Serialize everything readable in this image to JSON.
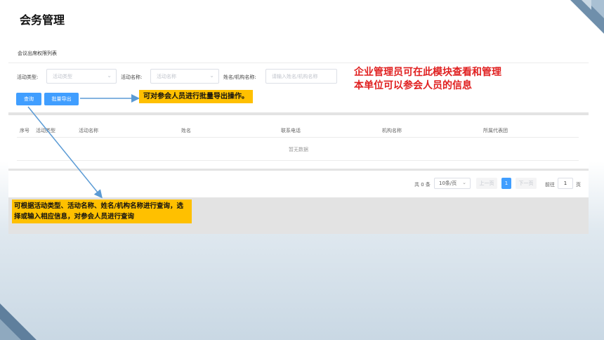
{
  "slide": {
    "title": "会务管理"
  },
  "card": {
    "title": "会议出席权限列表"
  },
  "filters": {
    "activity_type": {
      "label": "活动类型:",
      "placeholder": "活动类型"
    },
    "activity_name": {
      "label": "活动名称:",
      "placeholder": "活动名称"
    },
    "org_name": {
      "label": "姓名/机构名称:",
      "placeholder": "请输入姓名/机构名称"
    }
  },
  "buttons": {
    "query": "查询",
    "batch_export": "批量导出"
  },
  "table": {
    "columns": [
      "序号",
      "活动类型",
      "活动名称",
      "姓名",
      "联系电话",
      "机构名称",
      "所属代表团"
    ],
    "empty_text": "暂无数据"
  },
  "pagination": {
    "total": "共 0 条",
    "page_size": "10条/页",
    "prev": "上一页",
    "current_page": "1",
    "next": "下一页",
    "goto_label": "前往",
    "goto_value": "1",
    "page_unit": "页"
  },
  "annotations": {
    "main": "企业管理员可在此模块查看和管理本单位可以参会人员的信息",
    "export_note": "可对参会人员进行批量导出操作。",
    "query_note": "可根据活动类型、活动名称、姓名/机构名称进行查询，选择或输入相应信息，对参会人员进行查询"
  },
  "colors": {
    "primary": "#409eff",
    "annotation_red": "#e02020",
    "callout_bg": "#ffc000",
    "arrow": "#5b9bd5"
  }
}
